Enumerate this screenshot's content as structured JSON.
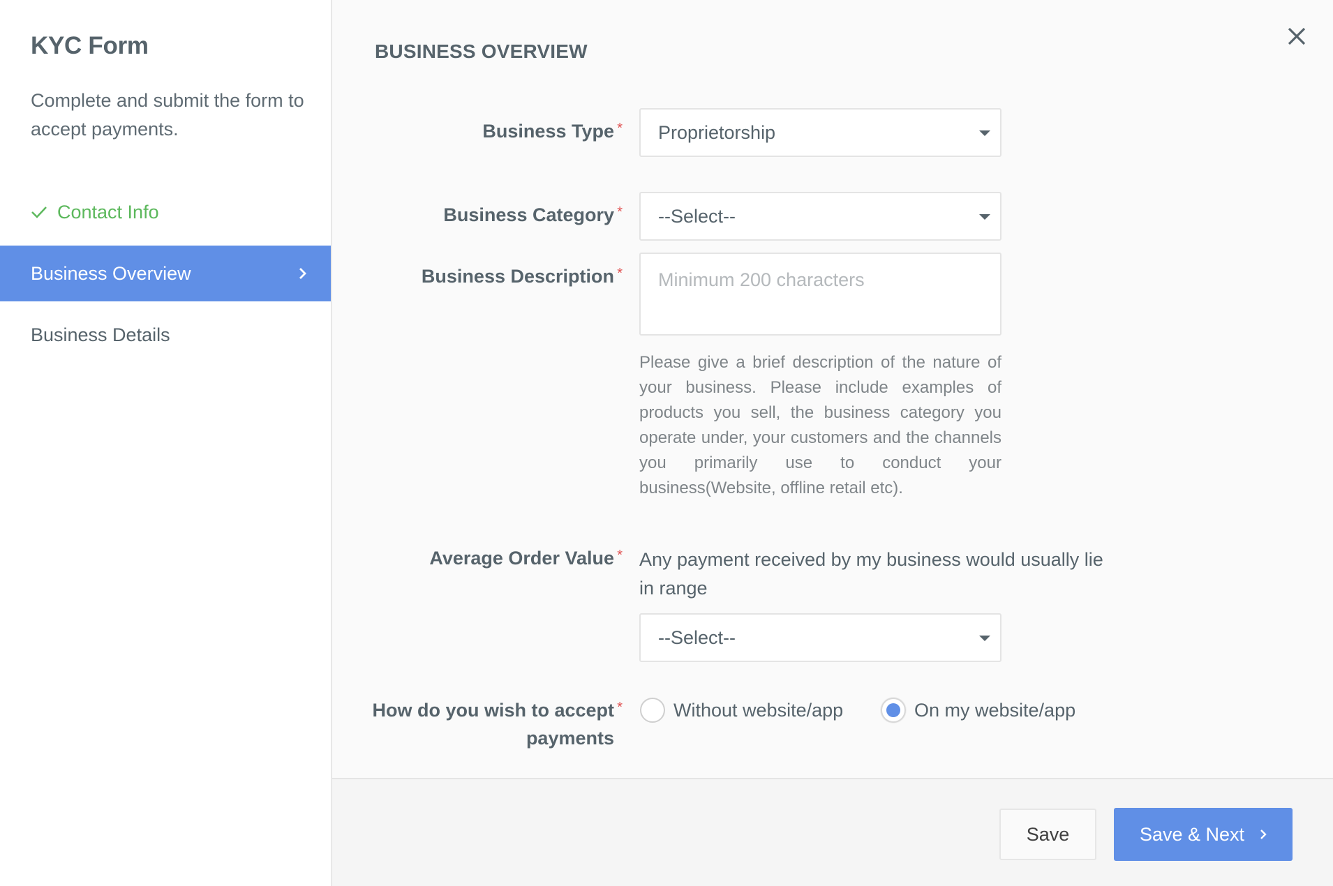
{
  "sidebar": {
    "title": "KYC Form",
    "description": "Complete and submit the form to accept payments.",
    "items": [
      {
        "label": "Contact Info",
        "status": "completed",
        "icon": "check-icon"
      },
      {
        "label": "Business Overview",
        "status": "active",
        "icon": "chevron-right-icon"
      },
      {
        "label": "Business Details",
        "status": "pending"
      }
    ]
  },
  "colors": {
    "accent": "#608fe6",
    "success": "#5cb85c",
    "required": "#e05252",
    "text": "#56636b"
  },
  "main": {
    "section_title": "BUSINESS OVERVIEW",
    "close_icon": "close-icon",
    "fields": {
      "business_type": {
        "label": "Business Type",
        "required": "*",
        "value": "Proprietorship"
      },
      "business_category": {
        "label": "Business Category",
        "required": "*",
        "value": "--Select--"
      },
      "business_description": {
        "label": "Business Description",
        "required": "*",
        "value": "",
        "placeholder": "Minimum 200 characters",
        "help": "Please give a brief description of the nature of your business. Please include examples of products you sell, the business category you operate under, your customers and the channels you primarily use to conduct your business(Website, offline retail etc)."
      },
      "average_order_value": {
        "label": "Average Order Value",
        "required": "*",
        "hint": "Any payment received by my business would usually lie in range",
        "value": "--Select--"
      },
      "accept_payments": {
        "label_line1": "How do you wish to accept",
        "label_line2": "payments",
        "required": "*",
        "options": [
          {
            "label": "Without website/app",
            "checked": false
          },
          {
            "label": "On my website/app",
            "checked": true
          }
        ]
      }
    }
  },
  "footer": {
    "save_label": "Save",
    "save_next_label": "Save & Next"
  }
}
